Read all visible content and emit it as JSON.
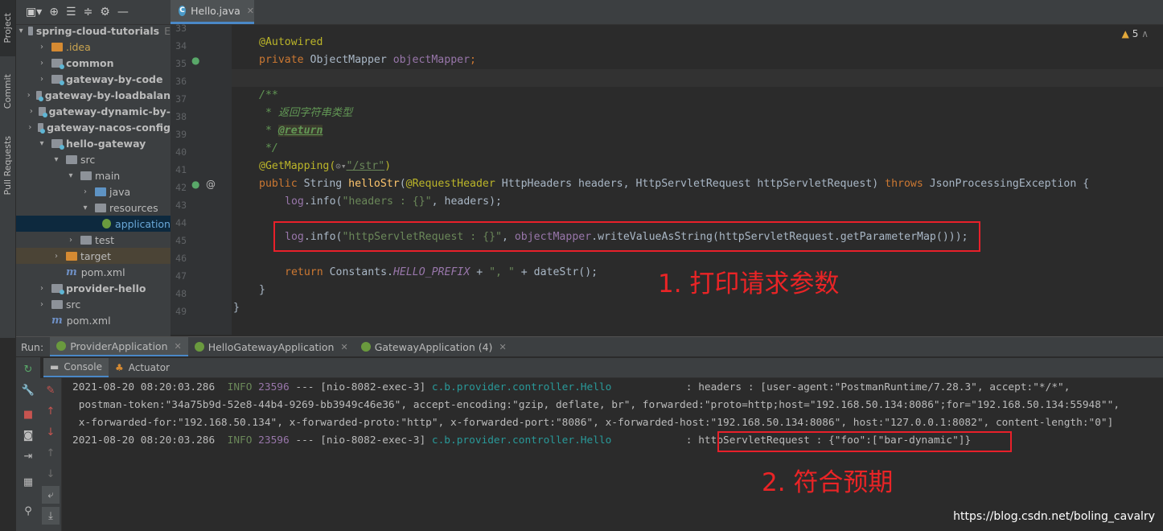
{
  "sidebar": {
    "tabs": [
      "Project",
      "Commit",
      "Pull Requests"
    ]
  },
  "project_tree": {
    "rows": [
      {
        "label": "spring-cloud-tutorials",
        "suffix": "E"
      },
      {
        "label": ".idea"
      },
      {
        "label": "common"
      },
      {
        "label": "gateway-by-code"
      },
      {
        "label": "gateway-by-loadbalan"
      },
      {
        "label": "gateway-dynamic-by-"
      },
      {
        "label": "gateway-nacos-config"
      },
      {
        "label": "hello-gateway"
      },
      {
        "label": "src"
      },
      {
        "label": "main"
      },
      {
        "label": "java"
      },
      {
        "label": "resources"
      },
      {
        "label": "application"
      },
      {
        "label": "test"
      },
      {
        "label": "target"
      },
      {
        "label": "pom.xml"
      },
      {
        "label": "provider-hello"
      },
      {
        "label": "src"
      },
      {
        "label": "pom.xml"
      }
    ]
  },
  "editor": {
    "tab_label": "Hello.java",
    "warnings": "5",
    "line_numbers": [
      "33",
      "34",
      "35",
      "36",
      "37",
      "38",
      "39",
      "40",
      "41",
      "42",
      "43",
      "44",
      "45",
      "46",
      "47",
      "48",
      "49"
    ],
    "code": {
      "l34": "@Autowired",
      "l35_kw": "private",
      "l35_type": " ObjectMapper ",
      "l35_field": "objectMapper",
      "l35_end": ";",
      "l37": "/**",
      "l38": " * 返回字符串类型",
      "l39_star": " * ",
      "l39_tag": "@return",
      "l40": " */",
      "l41_ann": "@GetMapping(",
      "l41_icon": "⊙▾",
      "l41_str": "\"/str\"",
      "l41_end": ")",
      "l42_kw": "public",
      "l42_type": " String ",
      "l42_meth": "helloStr",
      "l42_p1": "(",
      "l42_ann": "@RequestHeader",
      "l42_p2": " HttpHeaders headers, HttpServletRequest httpServletRequest) ",
      "l42_throws": "throws",
      "l42_end": " JsonProcessingException {",
      "l43_fld": "log",
      "l43_a": ".info(",
      "l43_str": "\"headers : {}\"",
      "l43_b": ", headers);",
      "l45_fld": "log",
      "l45_a": ".info(",
      "l45_str": "\"httpServletRequest : {}\"",
      "l45_b": ", ",
      "l45_fld2": "objectMapper",
      "l45_c": ".writeValueAsString(httpServletRequest.getParameterMap()));",
      "l47_kw": "return",
      "l47_a": " Constants.",
      "l47_cst": "HELLO_PREFIX",
      "l47_b": " + ",
      "l47_str": "\", \"",
      "l47_c": " + dateStr();",
      "l48": "}",
      "l49": "}"
    },
    "annotation_1": "1. 打印请求参数"
  },
  "run": {
    "label": "Run:",
    "tabs": [
      "ProviderApplication",
      "HelloGatewayApplication",
      "GatewayApplication (4)"
    ],
    "subtabs": [
      "Console",
      "Actuator"
    ],
    "log": {
      "l1_ts": "2021-08-20 08:20:03.286  ",
      "l1_level": "INFO",
      "l1_pid": " 23596",
      "l1_thread": " --- [nio-8082-exec-3] ",
      "l1_cls": "c.b.provider.controller.Hello",
      "l1_msg": "            : headers : [user-agent:\"PostmanRuntime/7.28.3\", accept:\"*/*\",",
      "l2": " postman-token:\"34a75b9d-52e8-44b4-9269-bb3949c46e36\", accept-encoding:\"gzip, deflate, br\", forwarded:\"proto=http;host=\"192.168.50.134:8086\";for=\"192.168.50.134:55948\"\",",
      "l3": " x-forwarded-for:\"192.168.50.134\", x-forwarded-proto:\"http\", x-forwarded-port:\"8086\", x-forwarded-host:\"192.168.50.134:8086\", host:\"127.0.0.1:8082\", content-length:\"0\"]",
      "l4_ts": "2021-08-20 08:20:03.286  ",
      "l4_level": "INFO",
      "l4_pid": " 23596",
      "l4_thread": " --- [nio-8082-exec-3] ",
      "l4_cls": "c.b.provider.controller.Hello",
      "l4_sep": "            : ",
      "l4_msg": "httpServletRequest : {\"foo\":[\"bar-dynamic\"]}"
    },
    "annotation_2": "2. 符合预期"
  },
  "watermark": "https://blog.csdn.net/boling_cavalry"
}
